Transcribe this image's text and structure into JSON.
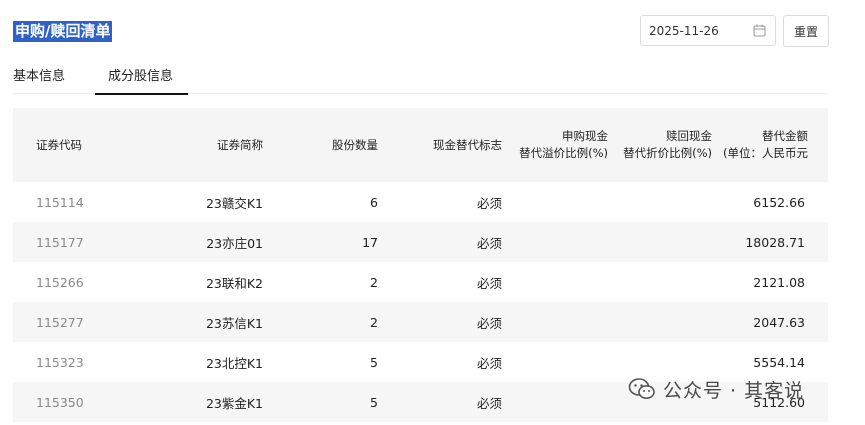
{
  "header": {
    "title": "申购/赎回清单",
    "date_value": "2025-11-26",
    "date_icon": "calendar-icon",
    "reset_label": "重置"
  },
  "tabs": [
    {
      "label": "基本信息",
      "active": false
    },
    {
      "label": "成分股信息",
      "active": true
    }
  ],
  "table": {
    "columns": {
      "code": "证券代码",
      "name": "证券简称",
      "qty": "股份数量",
      "flag": "现金替代标志",
      "premium_1": "申购现金",
      "premium_2": "替代溢价比例(%)",
      "discount_1": "赎回现金",
      "discount_2": "替代折价比例(%)",
      "amount_1": "替代金额",
      "amount_2": "(单位：人民币元"
    },
    "rows": [
      {
        "code": "115114",
        "name": "23赣交K1",
        "qty": "6",
        "flag": "必须",
        "premium": "",
        "discount": "",
        "amount": "6152.66"
      },
      {
        "code": "115177",
        "name": "23亦庄01",
        "qty": "17",
        "flag": "必须",
        "premium": "",
        "discount": "",
        "amount": "18028.71"
      },
      {
        "code": "115266",
        "name": "23联和K2",
        "qty": "2",
        "flag": "必须",
        "premium": "",
        "discount": "",
        "amount": "2121.08"
      },
      {
        "code": "115277",
        "name": "23苏信K1",
        "qty": "2",
        "flag": "必须",
        "premium": "",
        "discount": "",
        "amount": "2047.63"
      },
      {
        "code": "115323",
        "name": "23北控K1",
        "qty": "5",
        "flag": "必须",
        "premium": "",
        "discount": "",
        "amount": "5554.14"
      },
      {
        "code": "115350",
        "name": "23紫金K1",
        "qty": "5",
        "flag": "必须",
        "premium": "",
        "discount": "",
        "amount": "5112.60"
      }
    ]
  },
  "watermark": {
    "text": "公众号 · 其客说",
    "icon": "wechat-icon"
  },
  "colors": {
    "title_highlight": "#2f62c9",
    "header_bg": "#f5f5f5",
    "stripe_bg": "#f6f6f6",
    "code_text": "#8a8a8a"
  }
}
